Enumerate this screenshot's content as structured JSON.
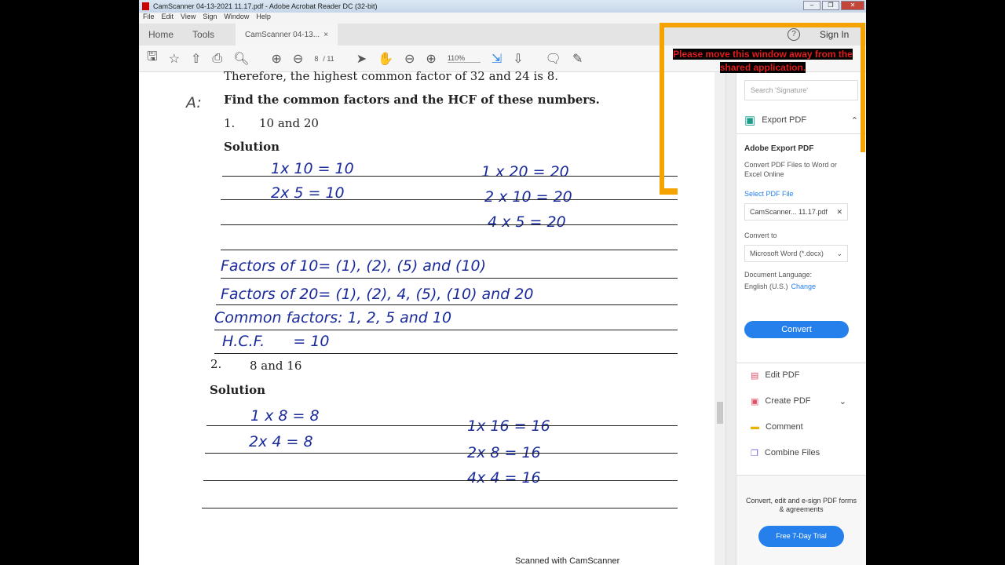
{
  "window": {
    "title": "CamScanner 04-13-2021 11.17.pdf - Adobe Acrobat Reader DC (32-bit)"
  },
  "menu": [
    "File",
    "Edit",
    "View",
    "Sign",
    "Window",
    "Help"
  ],
  "tabs": {
    "home": "Home",
    "tools": "Tools",
    "doc": "CamScanner 04-13...",
    "close": "×"
  },
  "toolbar": {
    "page_current": "8",
    "page_total": "/ 11",
    "zoom": "110%"
  },
  "header": {
    "help": "?",
    "sign_in": "Sign In"
  },
  "warning": {
    "line1": "Please move this window away from the",
    "line2": "shared application."
  },
  "document": {
    "line_top": "Therefore, the highest common factor of 32 and 24 is 8.",
    "margin_note": "A:",
    "heading": "Find the common factors and the HCF of these numbers.",
    "q1_num": "1.",
    "q1": "10 and 20",
    "solution1": "Solution",
    "hw1": [
      "1x 10 = 10",
      "2x 5 = 10",
      "1 x 20 = 20",
      "2 x 10 = 20",
      "4 x 5 = 20"
    ],
    "f10": "Factors of 10= (1), (2), (5) and (10)",
    "f20": "Factors of 20= (1), (2), 4, (5), (10) and 20",
    "common": "Common factors: 1, 2, 5 and 10",
    "hcf": "H.C.F.      = 10",
    "q2_num": "2.",
    "q2": "8 and 16",
    "solution2": "Solution",
    "hw2": [
      "1 x 8 = 8",
      "2x 4 = 8",
      "1x 16 = 16",
      "2x 8 = 16",
      "4x 4 = 16"
    ],
    "footer": "Scanned with CamScanner"
  },
  "panel": {
    "search_placeholder": "Search 'Signature'",
    "export_title": "Export PDF",
    "adobe_export": "Adobe Export PDF",
    "desc": "Convert PDF Files to Word or Excel Online",
    "select_file": "Select PDF File",
    "file_name": "CamScanner... 11.17.pdf",
    "convert_to": "Convert to",
    "format": "Microsoft Word (*.docx)",
    "doc_lang": "Document Language:",
    "lang": "English (U.S.)",
    "change": "Change",
    "convert": "Convert",
    "tools": [
      "Edit PDF",
      "Create PDF",
      "Comment",
      "Combine Files"
    ],
    "promo": "Convert, edit and e-sign PDF forms & agreements",
    "trial": "Free 7-Day Trial"
  },
  "colors": {
    "accent": "#2680eb",
    "highlight": "#f5a300",
    "ink": "#1a2a9a"
  }
}
